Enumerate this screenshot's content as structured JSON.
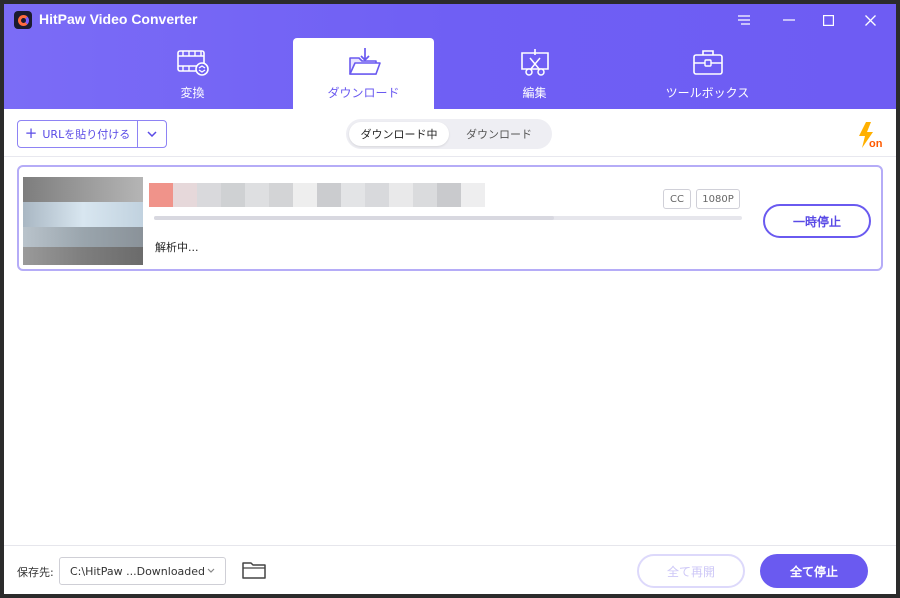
{
  "app": {
    "title": "HitPaw Video Converter"
  },
  "tabs": [
    {
      "label": "変換",
      "icon": "film-convert-icon",
      "active": false
    },
    {
      "label": "ダウンロード",
      "icon": "download-folder-icon",
      "active": true
    },
    {
      "label": "編集",
      "icon": "edit-scissors-icon",
      "active": false
    },
    {
      "label": "ツールボックス",
      "icon": "toolbox-icon",
      "active": false
    }
  ],
  "toolbar": {
    "paste_url_label": "URLを貼り付ける",
    "segments": [
      {
        "label": "ダウンロード中",
        "active": true
      },
      {
        "label": "ダウンロード",
        "active": false
      }
    ]
  },
  "download_item": {
    "status": "解析中...",
    "tags": [
      "CC",
      "1080P"
    ],
    "pause_label": "一時停止"
  },
  "footer": {
    "save_label": "保存先:",
    "path": "C:\\HitPaw ...Downloaded",
    "resume_all_label": "全て再開",
    "stop_all_label": "全て停止"
  },
  "colors": {
    "accent": "#6a5af0",
    "header_start": "#7b6cf6",
    "header_end": "#6e5cf3"
  }
}
